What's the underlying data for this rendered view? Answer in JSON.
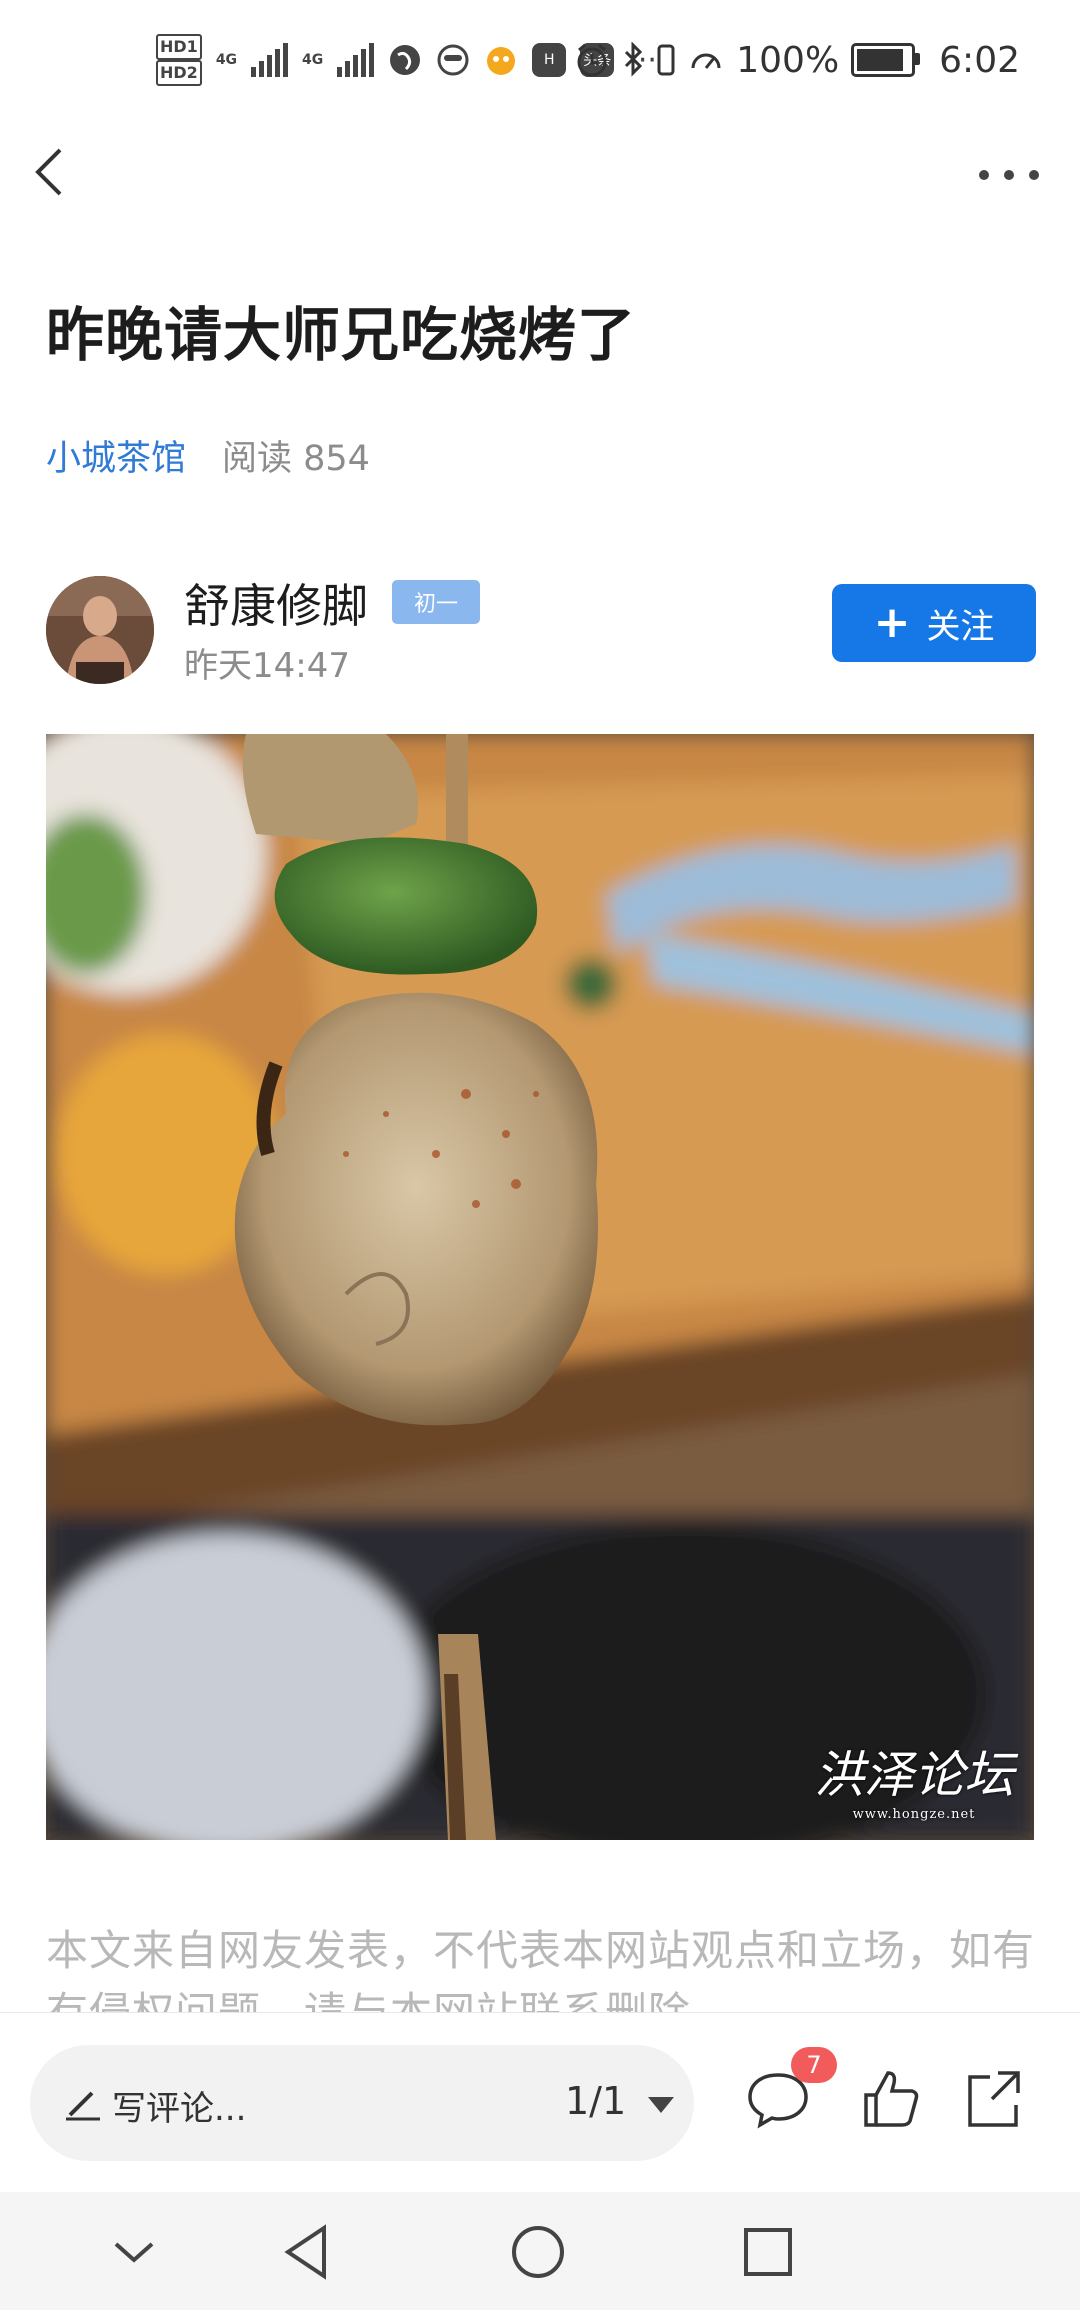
{
  "status_bar": {
    "hd1": "HD1",
    "hd2": "HD2",
    "net1": "4G",
    "net2": "4G",
    "more": "···",
    "app_label": "头条",
    "battery_text": "100%",
    "battery_level": 1.0,
    "time": "6:02"
  },
  "nav": {
    "back_icon": "chevron-left-icon",
    "more_icon": "more-dots-icon"
  },
  "article": {
    "title": "昨晚请大师兄吃烧烤了",
    "category": "小城茶馆",
    "reads": "阅读 854"
  },
  "author": {
    "name": "舒康修脚",
    "badge": "初一",
    "time": "昨天14:47",
    "follow_label": "关注"
  },
  "photo": {
    "watermark": "洪泽论坛",
    "watermark_url": "www.hongze.net"
  },
  "disclaimer": "本文来自网友发表，不代表本网站观点和立场，如有有侵权问题，请与本网站联系删除。",
  "bottom_bar": {
    "comment_placeholder": "写评论...",
    "page_indicator": "1/1",
    "comment_count": "7"
  },
  "colors": {
    "accent": "#1677e6",
    "link": "#2f7bd6",
    "badge": "#8ab8ee",
    "notify": "#f15b5b"
  }
}
